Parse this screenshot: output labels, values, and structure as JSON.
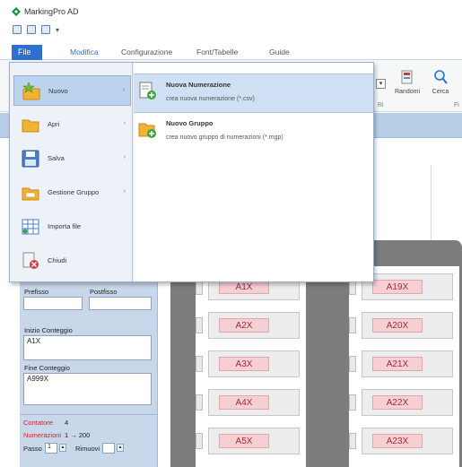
{
  "app": {
    "title": "MarkingPro AD"
  },
  "tabs": {
    "file": "File",
    "modifica": "Modifica",
    "configurazione": "Configurazione",
    "font_tabelle": "Font/Tabelle",
    "guide": "Guide"
  },
  "ribbon": {
    "buttons": [
      {
        "label": "Randomi"
      },
      {
        "label": "Cerca"
      }
    ],
    "groups": [
      "Ri",
      "Fi"
    ]
  },
  "file_menu": {
    "items": [
      {
        "label": "Nuovo",
        "has_arrow": true,
        "icon": "new-star-folder-icon"
      },
      {
        "label": "Apri",
        "has_arrow": true,
        "icon": "folder-open-icon"
      },
      {
        "label": "Salva",
        "has_arrow": true,
        "icon": "save-disk-icon"
      },
      {
        "label": "Gestione Gruppo",
        "has_arrow": true,
        "icon": "group-folder-icon"
      },
      {
        "label": "Importa file",
        "has_arrow": false,
        "icon": "import-table-icon"
      },
      {
        "label": "Chiudi",
        "has_arrow": false,
        "icon": "close-document-icon"
      }
    ],
    "submenu": [
      {
        "title": "Nuova Numerazione",
        "desc": "crea nuova numerazione (*.csv)",
        "icon": "new-numbering-icon"
      },
      {
        "title": "Nuovo Gruppo",
        "desc": "crea nuovo gruppo di numerazioni (*.mgp)",
        "icon": "new-group-icon"
      }
    ]
  },
  "properties": {
    "prefisso_label": "Prefisso",
    "postfisso_label": "Postfisso",
    "inizio_label": "Inizio Conteggio",
    "inizio_value": "A1X",
    "fine_label": "Fine Conteggio",
    "fine_value": "A999X",
    "contatore_label": "Contatore",
    "contatore_value": "4",
    "numerazioni_label": "Numerazioni",
    "numerazioni_value": "1 → 200",
    "passo_label": "Passo",
    "passo_value": "1",
    "rimuovi_label": "Rimuovi"
  },
  "labels": {
    "left": [
      "A1X",
      "A2X",
      "A3X",
      "A4X",
      "A5X"
    ],
    "right": [
      "A19X",
      "A20X",
      "A21X",
      "A22X",
      "A23X"
    ]
  },
  "colors": {
    "accent": "#2f6fcf",
    "label_fill": "#f6cfd3",
    "label_text": "#9b2a3a",
    "panel": "#c9d7ea"
  }
}
